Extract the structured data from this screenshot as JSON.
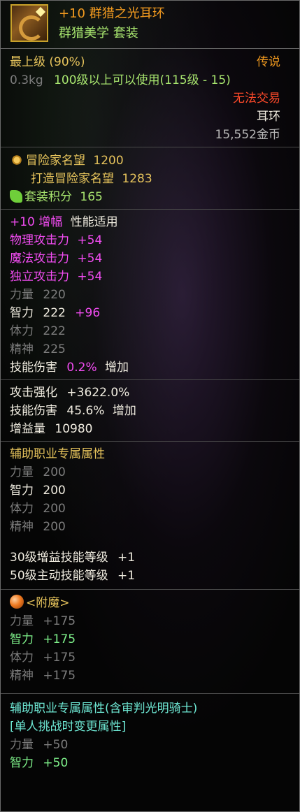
{
  "item": {
    "name": "+10 群猎之光耳环",
    "set_name": "群猎美学  套装",
    "icon": "earring-icon"
  },
  "info": {
    "grade": "最上级 (90%)",
    "rarity": "传说",
    "weight": "0.3kg",
    "level_req": "100级以上可以使用(115级 - 15)",
    "trade": "无法交易",
    "type": "耳环",
    "price": "15,552金币"
  },
  "fame": {
    "adventurer_label": "冒险家名望",
    "adventurer_value": "1200",
    "forged_label": "打造冒险家名望",
    "forged_value": "1283",
    "set_points_label": "套装积分",
    "set_points_value": "165"
  },
  "amplify": {
    "header_prefix": "+10 增幅",
    "header_suffix": "性能适用",
    "stats": [
      {
        "label": "物理攻击力",
        "value": "+54"
      },
      {
        "label": "魔法攻击力",
        "value": "+54"
      },
      {
        "label": "独立攻击力",
        "value": "+54"
      }
    ],
    "strength": {
      "label": "力量",
      "value": "220"
    },
    "intelligence": {
      "label": "智力",
      "value": "222",
      "bonus": "+96"
    },
    "vitality": {
      "label": "体力",
      "value": "222"
    },
    "spirit": {
      "label": "精神",
      "value": "225"
    },
    "skill_damage": {
      "label": "技能伤害",
      "value": "0.2%",
      "suffix": "增加"
    }
  },
  "enhance": {
    "attack_boost": {
      "label": "攻击强化",
      "value": "+3622.0%"
    },
    "skill_damage": {
      "label": "技能伤害",
      "value": "45.6%",
      "suffix": "增加"
    },
    "buff_power": {
      "label": "增益量",
      "value": "10980"
    }
  },
  "support": {
    "title": "辅助职业专属属性",
    "strength": {
      "label": "力量",
      "value": "200"
    },
    "intelligence": {
      "label": "智力",
      "value": "200"
    },
    "vitality": {
      "label": "体力",
      "value": "200"
    },
    "spirit": {
      "label": "精神",
      "value": "200"
    },
    "skill1": {
      "label": "30级增益技能等级",
      "value": "+1"
    },
    "skill2": {
      "label": "50级主动技能等级",
      "value": "+1"
    }
  },
  "enchant": {
    "title": "<附魔>",
    "strength": {
      "label": "力量",
      "value": "+175"
    },
    "intelligence": {
      "label": "智力",
      "value": "+175"
    },
    "vitality": {
      "label": "体力",
      "value": "+175"
    },
    "spirit": {
      "label": "精神",
      "value": "+175"
    }
  },
  "support2": {
    "title": "辅助职业专属属性(含审判光明骑士)",
    "subtitle": "[单人挑战时变更属性]",
    "strength": {
      "label": "力量",
      "value": "+50"
    },
    "intelligence": {
      "label": "智力",
      "value": "+50"
    }
  }
}
